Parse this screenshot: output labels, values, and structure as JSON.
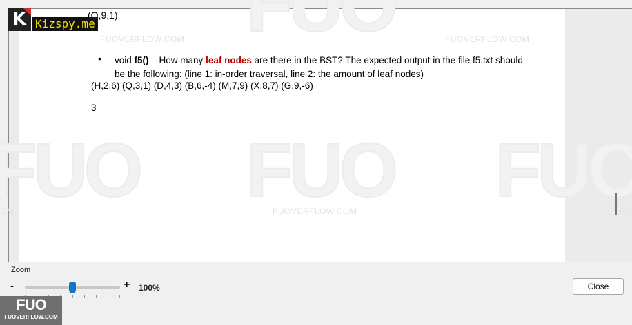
{
  "document": {
    "top_fragment": "(Q,9,1)",
    "bullet_glyph": "•",
    "bullet_prefix": "void ",
    "function_name": "f5()",
    "bullet_dash": " – How many ",
    "highlight": "leaf nodes",
    "bullet_rest": " are there in the BST? The expected output in the file f5.txt should be the following: (line 1: in-order traversal, line 2: the amount of leaf nodes)",
    "data_line": "(H,2,6) (Q,3,1) (D,4,3) (B,6,-4) (M,7,9) (X,8,7) (G,9,-6)",
    "answer": "3"
  },
  "watermarks": {
    "site_text": "FUOVERFLOW.COM",
    "big_text": "FUO",
    "edge_text": "OM",
    "edge_right_text": "FU"
  },
  "logo": {
    "letter": "K",
    "name": "Kizspy.me"
  },
  "zoom": {
    "label": "Zoom",
    "minus": "-",
    "plus": "+",
    "value": "100%",
    "slider_level": 0.5
  },
  "buttons": {
    "close": "Close"
  },
  "corner_logo": {
    "big": "FUO",
    "small": "FUOVERFLOW.COM"
  },
  "colors": {
    "highlight": "#c00000",
    "slider_thumb": "#1a73c9"
  }
}
